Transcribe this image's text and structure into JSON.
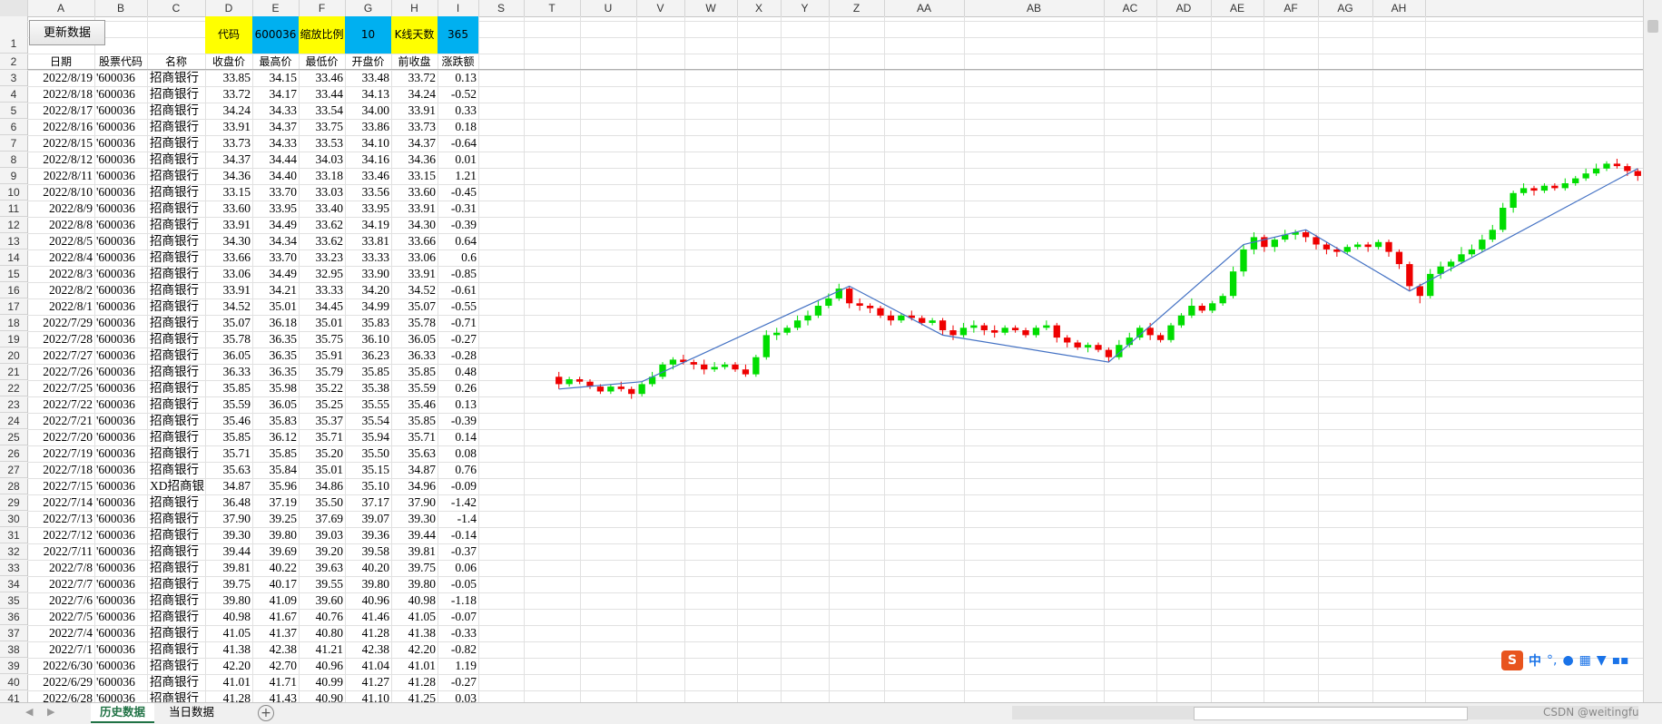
{
  "columns": [
    "A",
    "B",
    "C",
    "D",
    "E",
    "F",
    "G",
    "H",
    "I",
    "S",
    "T",
    "U",
    "V",
    "W",
    "X",
    "Y",
    "Z",
    "AA",
    "AB",
    "AC",
    "AD",
    "AE",
    "AF",
    "AG",
    "AH"
  ],
  "button": {
    "label": "更新数据"
  },
  "params": {
    "code_label": "代码",
    "code_value": "600036",
    "scale_label": "缩放比例",
    "scale_value": "10",
    "days_label": "K线天数",
    "days_value": "365"
  },
  "headers": [
    "日期",
    "股票代码",
    "名称",
    "收盘价",
    "最高价",
    "最低价",
    "开盘价",
    "前收盘",
    "涨跌额"
  ],
  "rows": [
    [
      "2022/8/19",
      "'600036",
      "招商银行",
      "33.85",
      "34.15",
      "33.46",
      "33.48",
      "33.72",
      "0.13"
    ],
    [
      "2022/8/18",
      "'600036",
      "招商银行",
      "33.72",
      "34.17",
      "33.44",
      "34.13",
      "34.24",
      "-0.52"
    ],
    [
      "2022/8/17",
      "'600036",
      "招商银行",
      "34.24",
      "34.33",
      "33.54",
      "34.00",
      "33.91",
      "0.33"
    ],
    [
      "2022/8/16",
      "'600036",
      "招商银行",
      "33.91",
      "34.37",
      "33.75",
      "33.86",
      "33.73",
      "0.18"
    ],
    [
      "2022/8/15",
      "'600036",
      "招商银行",
      "33.73",
      "34.33",
      "33.53",
      "34.10",
      "34.37",
      "-0.64"
    ],
    [
      "2022/8/12",
      "'600036",
      "招商银行",
      "34.37",
      "34.44",
      "34.03",
      "34.16",
      "34.36",
      "0.01"
    ],
    [
      "2022/8/11",
      "'600036",
      "招商银行",
      "34.36",
      "34.40",
      "33.18",
      "33.46",
      "33.15",
      "1.21"
    ],
    [
      "2022/8/10",
      "'600036",
      "招商银行",
      "33.15",
      "33.70",
      "33.03",
      "33.56",
      "33.60",
      "-0.45"
    ],
    [
      "2022/8/9",
      "'600036",
      "招商银行",
      "33.60",
      "33.95",
      "33.40",
      "33.95",
      "33.91",
      "-0.31"
    ],
    [
      "2022/8/8",
      "'600036",
      "招商银行",
      "33.91",
      "34.49",
      "33.62",
      "34.19",
      "34.30",
      "-0.39"
    ],
    [
      "2022/8/5",
      "'600036",
      "招商银行",
      "34.30",
      "34.34",
      "33.62",
      "33.81",
      "33.66",
      "0.64"
    ],
    [
      "2022/8/4",
      "'600036",
      "招商银行",
      "33.66",
      "33.70",
      "33.23",
      "33.33",
      "33.06",
      "0.6"
    ],
    [
      "2022/8/3",
      "'600036",
      "招商银行",
      "33.06",
      "34.49",
      "32.95",
      "33.90",
      "33.91",
      "-0.85"
    ],
    [
      "2022/8/2",
      "'600036",
      "招商银行",
      "33.91",
      "34.21",
      "33.33",
      "34.20",
      "34.52",
      "-0.61"
    ],
    [
      "2022/8/1",
      "'600036",
      "招商银行",
      "34.52",
      "35.01",
      "34.45",
      "34.99",
      "35.07",
      "-0.55"
    ],
    [
      "2022/7/29",
      "'600036",
      "招商银行",
      "35.07",
      "36.18",
      "35.01",
      "35.83",
      "35.78",
      "-0.71"
    ],
    [
      "2022/7/28",
      "'600036",
      "招商银行",
      "35.78",
      "36.35",
      "35.75",
      "36.10",
      "36.05",
      "-0.27"
    ],
    [
      "2022/7/27",
      "'600036",
      "招商银行",
      "36.05",
      "36.35",
      "35.91",
      "36.23",
      "36.33",
      "-0.28"
    ],
    [
      "2022/7/26",
      "'600036",
      "招商银行",
      "36.33",
      "36.35",
      "35.79",
      "35.85",
      "35.85",
      "0.48"
    ],
    [
      "2022/7/25",
      "'600036",
      "招商银行",
      "35.85",
      "35.98",
      "35.22",
      "35.38",
      "35.59",
      "0.26"
    ],
    [
      "2022/7/22",
      "'600036",
      "招商银行",
      "35.59",
      "36.05",
      "35.25",
      "35.55",
      "35.46",
      "0.13"
    ],
    [
      "2022/7/21",
      "'600036",
      "招商银行",
      "35.46",
      "35.83",
      "35.37",
      "35.54",
      "35.85",
      "-0.39"
    ],
    [
      "2022/7/20",
      "'600036",
      "招商银行",
      "35.85",
      "36.12",
      "35.71",
      "35.94",
      "35.71",
      "0.14"
    ],
    [
      "2022/7/19",
      "'600036",
      "招商银行",
      "35.71",
      "35.85",
      "35.20",
      "35.50",
      "35.63",
      "0.08"
    ],
    [
      "2022/7/18",
      "'600036",
      "招商银行",
      "35.63",
      "35.84",
      "35.01",
      "35.15",
      "34.87",
      "0.76"
    ],
    [
      "2022/7/15",
      "'600036",
      "XD招商银",
      "34.87",
      "35.96",
      "34.86",
      "35.10",
      "34.96",
      "-0.09"
    ],
    [
      "2022/7/14",
      "'600036",
      "招商银行",
      "36.48",
      "37.19",
      "35.50",
      "37.17",
      "37.90",
      "-1.42"
    ],
    [
      "2022/7/13",
      "'600036",
      "招商银行",
      "37.90",
      "39.25",
      "37.69",
      "39.07",
      "39.30",
      "-1.4"
    ],
    [
      "2022/7/12",
      "'600036",
      "招商银行",
      "39.30",
      "39.80",
      "39.03",
      "39.36",
      "39.44",
      "-0.14"
    ],
    [
      "2022/7/11",
      "'600036",
      "招商银行",
      "39.44",
      "39.69",
      "39.20",
      "39.58",
      "39.81",
      "-0.37"
    ],
    [
      "2022/7/8",
      "'600036",
      "招商银行",
      "39.81",
      "40.22",
      "39.63",
      "40.20",
      "39.75",
      "0.06"
    ],
    [
      "2022/7/7",
      "'600036",
      "招商银行",
      "39.75",
      "40.17",
      "39.55",
      "39.80",
      "39.80",
      "-0.05"
    ],
    [
      "2022/7/6",
      "'600036",
      "招商银行",
      "39.80",
      "41.09",
      "39.60",
      "40.96",
      "40.98",
      "-1.18"
    ],
    [
      "2022/7/5",
      "'600036",
      "招商银行",
      "40.98",
      "41.67",
      "40.76",
      "41.46",
      "41.05",
      "-0.07"
    ],
    [
      "2022/7/4",
      "'600036",
      "招商银行",
      "41.05",
      "41.37",
      "40.80",
      "41.28",
      "41.38",
      "-0.33"
    ],
    [
      "2022/7/1",
      "'600036",
      "招商银行",
      "41.38",
      "42.38",
      "41.21",
      "42.38",
      "42.20",
      "-0.82"
    ],
    [
      "2022/6/30",
      "'600036",
      "招商银行",
      "42.20",
      "42.70",
      "40.96",
      "41.04",
      "41.01",
      "1.19"
    ],
    [
      "2022/6/29",
      "'600036",
      "招商银行",
      "41.01",
      "41.71",
      "40.99",
      "41.27",
      "41.28",
      "-0.27"
    ],
    [
      "2022/6/28",
      "'600036",
      "招商银行",
      "41.28",
      "41.43",
      "40.90",
      "41.10",
      "41.25",
      "0.03"
    ]
  ],
  "chart_data": {
    "type": "candlestick",
    "candles": [
      [
        35.9,
        35.6,
        36.1,
        35.4
      ],
      [
        35.6,
        35.8,
        35.9,
        35.5
      ],
      [
        35.8,
        35.7,
        35.9,
        35.6
      ],
      [
        35.7,
        35.5,
        35.8,
        35.4
      ],
      [
        35.5,
        35.3,
        35.6,
        35.2
      ],
      [
        35.3,
        35.5,
        35.6,
        35.2
      ],
      [
        35.5,
        35.4,
        35.7,
        35.3
      ],
      [
        35.4,
        35.2,
        35.5,
        35.0
      ],
      [
        35.2,
        35.6,
        35.7,
        35.1
      ],
      [
        35.6,
        35.9,
        36.1,
        35.5
      ],
      [
        35.9,
        36.4,
        36.5,
        35.8
      ],
      [
        36.4,
        36.6,
        36.7,
        36.2
      ],
      [
        36.6,
        36.5,
        36.8,
        36.4
      ],
      [
        36.5,
        36.4,
        36.6,
        36.2
      ],
      [
        36.4,
        36.2,
        36.6,
        36.0
      ],
      [
        36.2,
        36.3,
        36.5,
        36.1
      ],
      [
        36.3,
        36.4,
        36.5,
        36.2
      ],
      [
        36.4,
        36.2,
        36.5,
        36.1
      ],
      [
        36.2,
        36.0,
        36.4,
        35.9
      ],
      [
        36.0,
        36.7,
        36.8,
        35.9
      ],
      [
        36.7,
        37.6,
        37.8,
        36.6
      ],
      [
        37.6,
        37.7,
        37.9,
        37.4
      ],
      [
        37.7,
        37.9,
        38.0,
        37.6
      ],
      [
        37.9,
        38.2,
        38.4,
        37.8
      ],
      [
        38.2,
        38.4,
        38.6,
        38.0
      ],
      [
        38.4,
        38.8,
        39.0,
        38.3
      ],
      [
        38.8,
        39.1,
        39.3,
        38.7
      ],
      [
        39.1,
        39.5,
        39.7,
        39.0
      ],
      [
        39.5,
        38.9,
        39.6,
        38.7
      ],
      [
        38.9,
        38.8,
        39.1,
        38.6
      ],
      [
        38.8,
        38.7,
        38.9,
        38.5
      ],
      [
        38.7,
        38.4,
        38.8,
        38.3
      ],
      [
        38.4,
        38.2,
        38.6,
        38.0
      ],
      [
        38.2,
        38.4,
        38.5,
        38.1
      ],
      [
        38.4,
        38.3,
        38.6,
        38.2
      ],
      [
        38.3,
        38.1,
        38.4,
        38.0
      ],
      [
        38.1,
        38.2,
        38.3,
        38.0
      ],
      [
        38.2,
        37.8,
        38.3,
        37.6
      ],
      [
        37.8,
        37.6,
        38.0,
        37.4
      ],
      [
        37.6,
        37.9,
        38.1,
        37.5
      ],
      [
        37.9,
        38.0,
        38.2,
        37.7
      ],
      [
        38.0,
        37.8,
        38.1,
        37.6
      ],
      [
        37.8,
        37.7,
        38.0,
        37.5
      ],
      [
        37.7,
        37.9,
        38.0,
        37.6
      ],
      [
        37.9,
        37.8,
        38.0,
        37.7
      ],
      [
        37.8,
        37.6,
        37.9,
        37.5
      ],
      [
        37.6,
        37.9,
        38.0,
        37.5
      ],
      [
        37.9,
        38.0,
        38.2,
        37.8
      ],
      [
        38.0,
        37.5,
        38.1,
        37.3
      ],
      [
        37.5,
        37.3,
        37.6,
        37.1
      ],
      [
        37.3,
        37.1,
        37.4,
        37.0
      ],
      [
        37.1,
        37.2,
        37.3,
        36.9
      ],
      [
        37.2,
        37.0,
        37.3,
        36.9
      ],
      [
        37.0,
        36.7,
        37.1,
        36.5
      ],
      [
        36.7,
        37.2,
        37.4,
        36.6
      ],
      [
        37.2,
        37.5,
        37.7,
        37.1
      ],
      [
        37.5,
        37.9,
        38.0,
        37.4
      ],
      [
        37.9,
        37.6,
        38.1,
        37.4
      ],
      [
        37.6,
        37.4,
        37.7,
        37.3
      ],
      [
        37.4,
        38.0,
        38.1,
        37.3
      ],
      [
        38.0,
        38.4,
        38.5,
        37.9
      ],
      [
        38.4,
        38.8,
        39.1,
        38.3
      ],
      [
        38.8,
        38.6,
        38.9,
        38.5
      ],
      [
        38.6,
        38.9,
        39.0,
        38.5
      ],
      [
        38.9,
        39.2,
        39.3,
        38.8
      ],
      [
        39.2,
        40.2,
        40.4,
        39.1
      ],
      [
        40.2,
        41.1,
        41.3,
        40.0
      ],
      [
        41.1,
        41.6,
        41.8,
        40.9
      ],
      [
        41.6,
        41.2,
        41.7,
        41.0
      ],
      [
        41.2,
        41.5,
        41.6,
        41.0
      ],
      [
        41.5,
        41.7,
        41.9,
        41.4
      ],
      [
        41.7,
        41.8,
        41.9,
        41.5
      ],
      [
        41.8,
        41.6,
        41.9,
        41.4
      ],
      [
        41.6,
        41.3,
        41.7,
        41.1
      ],
      [
        41.3,
        41.1,
        41.4,
        40.9
      ],
      [
        41.1,
        41.0,
        41.2,
        40.8
      ],
      [
        41.0,
        41.2,
        41.3,
        40.9
      ],
      [
        41.2,
        41.3,
        41.4,
        41.1
      ],
      [
        41.3,
        41.2,
        41.4,
        41.0
      ],
      [
        41.2,
        41.4,
        41.5,
        41.1
      ],
      [
        41.4,
        41.0,
        41.5,
        40.8
      ],
      [
        41.0,
        40.5,
        41.1,
        40.3
      ],
      [
        40.5,
        39.6,
        40.6,
        39.4
      ],
      [
        39.6,
        39.2,
        39.7,
        38.9
      ],
      [
        39.2,
        40.1,
        40.3,
        39.1
      ],
      [
        40.1,
        40.4,
        40.6,
        39.9
      ],
      [
        40.4,
        40.6,
        40.7,
        40.2
      ],
      [
        40.6,
        40.9,
        41.2,
        40.5
      ],
      [
        40.9,
        41.1,
        41.3,
        40.8
      ],
      [
        41.1,
        41.5,
        41.7,
        41.0
      ],
      [
        41.5,
        41.9,
        42.1,
        41.4
      ],
      [
        41.9,
        42.8,
        43.0,
        41.8
      ],
      [
        42.8,
        43.4,
        43.5,
        42.6
      ],
      [
        43.4,
        43.6,
        43.8,
        43.3
      ],
      [
        43.6,
        43.5,
        43.7,
        43.3
      ],
      [
        43.5,
        43.7,
        43.8,
        43.4
      ],
      [
        43.7,
        43.6,
        43.8,
        43.5
      ],
      [
        43.6,
        43.8,
        44.0,
        43.5
      ],
      [
        43.8,
        44.0,
        44.1,
        43.7
      ],
      [
        44.0,
        44.2,
        44.4,
        43.9
      ],
      [
        44.2,
        44.4,
        44.6,
        44.1
      ],
      [
        44.4,
        44.6,
        44.7,
        44.3
      ],
      [
        44.6,
        44.5,
        44.8,
        44.4
      ],
      [
        44.5,
        44.3,
        44.6,
        44.1
      ],
      [
        44.3,
        44.1,
        44.4,
        43.9
      ]
    ]
  },
  "sheets": [
    "历史数据",
    "当日数据"
  ],
  "watermark": "CSDN @weitingfu"
}
